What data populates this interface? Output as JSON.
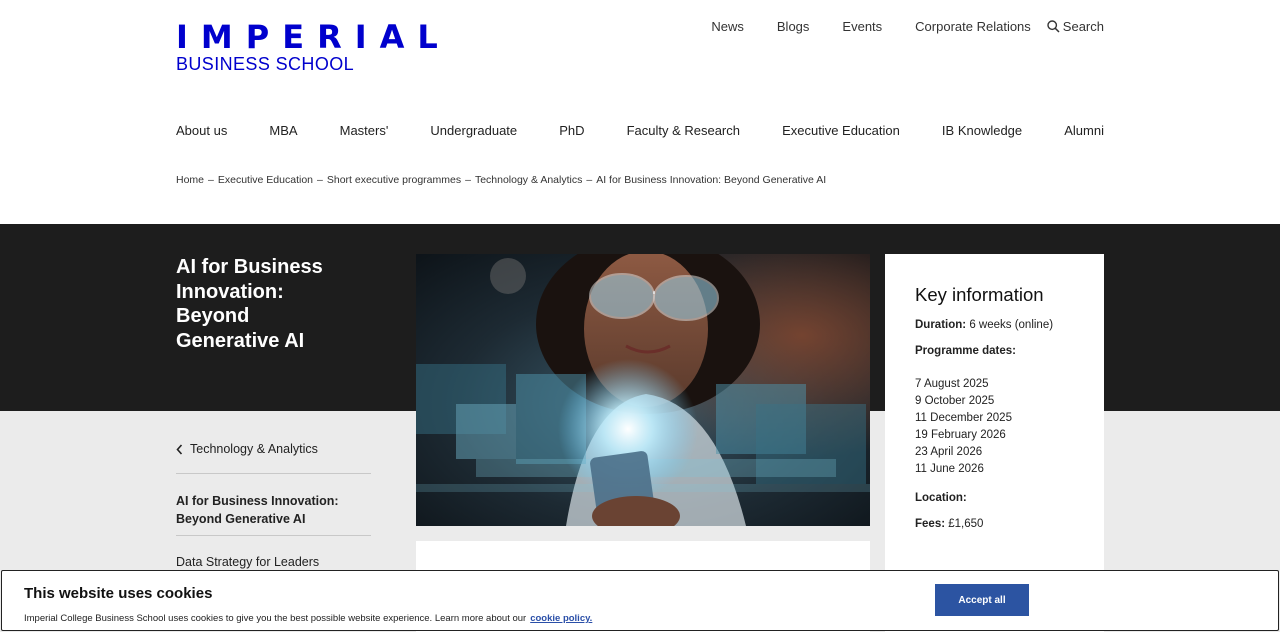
{
  "header": {
    "logo_main": "IMPERIAL",
    "logo_sub": "BUSINESS SCHOOL",
    "utility_nav": [
      "News",
      "Blogs",
      "Events",
      "Corporate Relations"
    ],
    "search_label": "Search"
  },
  "main_nav": [
    "About us",
    "MBA",
    "Masters'",
    "Undergraduate",
    "PhD",
    "Faculty & Research",
    "Executive Education",
    "IB Knowledge",
    "Alumni"
  ],
  "breadcrumb": {
    "separator": "–",
    "items": [
      "Home",
      "Executive Education",
      "Short executive programmes",
      "Technology & Analytics",
      "AI for Business Innovation: Beyond Generative AI"
    ]
  },
  "programme": {
    "title": "AI for Business Innovation: Beyond Generative AI"
  },
  "side_nav": {
    "back_label": "Technology & Analytics",
    "active_item": "AI for Business Innovation: Beyond Generative AI",
    "next_item": "Data Strategy for Leaders"
  },
  "key_info": {
    "heading": "Key information",
    "duration_label": "Duration:",
    "duration_value": "6 weeks (online)",
    "dates_label": "Programme dates:",
    "dates": [
      "7 August 2025",
      "9 October 2025",
      "11 December 2025",
      "19 February 2026",
      "23 April 2026",
      "11 June 2026"
    ],
    "location_label": "Location:",
    "fees_label": "Fees:",
    "fees_value": "£1,650"
  },
  "cookie_banner": {
    "title": "This website uses cookies",
    "text": "Imperial College Business School uses cookies to give you the best possible website experience. Learn more about our",
    "link_label": "cookie policy.",
    "accept_label": "Accept all"
  },
  "colors": {
    "brand_blue": "#0000cd",
    "hero_dark": "#1d1d1d",
    "accept_button": "#2c54a2"
  }
}
